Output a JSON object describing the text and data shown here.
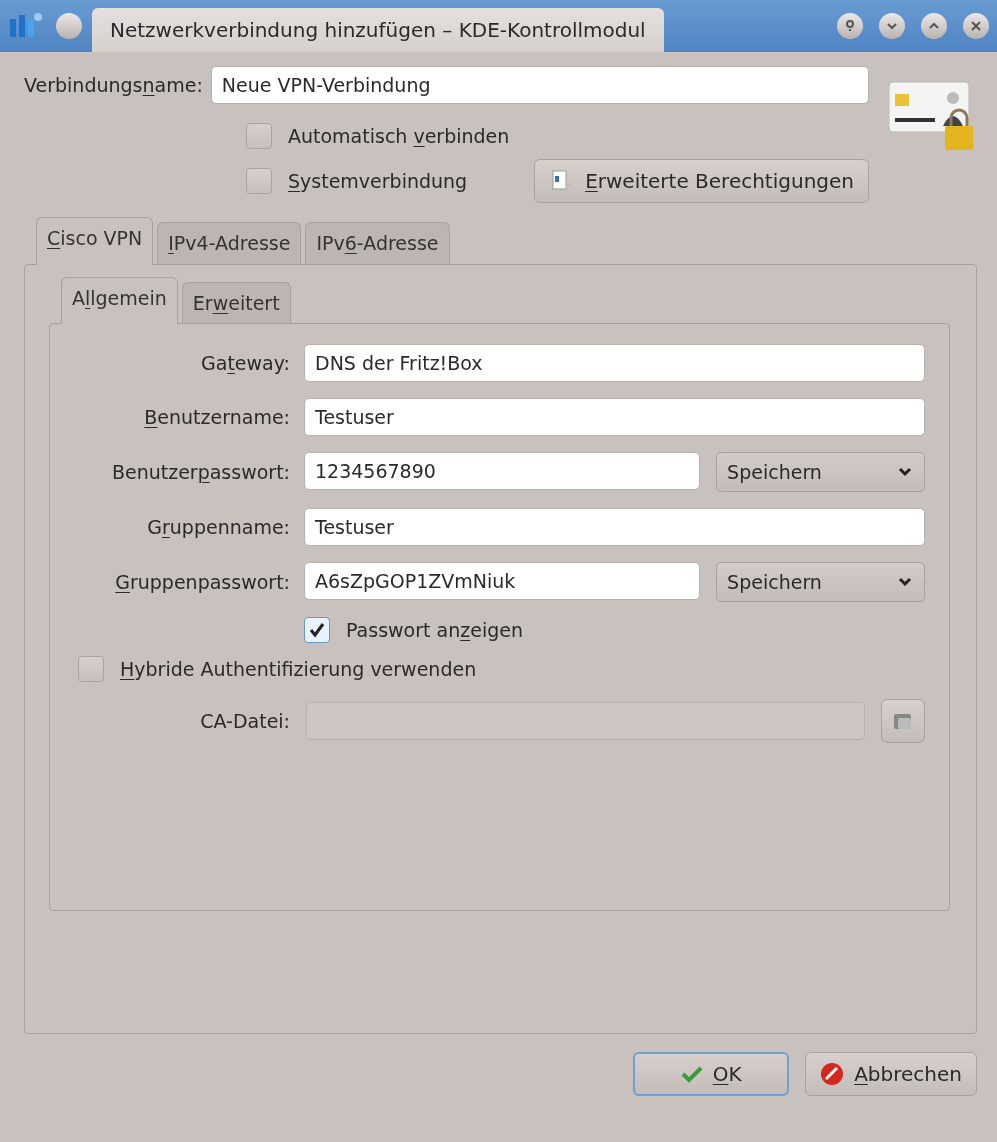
{
  "window": {
    "title": "Netzwerkverbindung hinzufügen – KDE-Kontrollmodul"
  },
  "connection_name": {
    "label": {
      "pre": "Verbindungs",
      "key": "n",
      "post": "ame:"
    },
    "value": "Neue VPN-Verbindung"
  },
  "options": [
    {
      "label": {
        "pre": "Automatisch ",
        "key": "v",
        "post": "erbinden"
      },
      "checked": false
    },
    {
      "label": {
        "key": "S",
        "post": "ystemverbindung"
      },
      "checked": false
    }
  ],
  "permissions_button": {
    "label": {
      "key": "E",
      "post": "rweiterte Berechtigungen"
    }
  },
  "tabs": [
    {
      "label": {
        "key": "C",
        "post": "isco VPN"
      },
      "selected": true
    },
    {
      "label": {
        "key": "I",
        "post": "Pv4-Adresse"
      },
      "selected": false
    },
    {
      "label": {
        "pre": "IPv",
        "key": "6",
        "post": "-Adresse"
      },
      "selected": false
    }
  ],
  "subtabs": [
    {
      "label": {
        "pre": "A",
        "key": "l",
        "post": "lgemein"
      },
      "selected": true
    },
    {
      "label": {
        "pre": "Er",
        "key": "w",
        "post": "eitert"
      },
      "selected": false
    }
  ],
  "fields": [
    {
      "kind": "text",
      "label": {
        "pre": "Ga",
        "key": "t",
        "post": "eway:"
      },
      "value": "DNS der Fritz!Box"
    },
    {
      "kind": "text",
      "label": {
        "key": "B",
        "post": "enutzername:"
      },
      "value": "Testuser"
    },
    {
      "kind": "secret",
      "label": {
        "pre": "Benutzer",
        "key": "p",
        "post": "asswort:"
      },
      "value": "1234567890",
      "store": "Speichern"
    },
    {
      "kind": "text",
      "label": {
        "pre": "G",
        "key": "r",
        "post": "uppenname:"
      },
      "value": "Testuser"
    },
    {
      "kind": "secret",
      "label": {
        "key": "G",
        "post": "ruppenpasswort:"
      },
      "value": "A6sZpGOP1ZVmNiuk",
      "store": "Speichern"
    }
  ],
  "show_password": {
    "label": {
      "pre": "Passwort an",
      "key": "z",
      "post": "eigen"
    },
    "checked": true
  },
  "hybrid_auth": {
    "label": {
      "key": "H",
      "post": "ybride Authentifizierung verwenden"
    },
    "checked": false
  },
  "ca_file": {
    "label": "CA-Datei:",
    "disabled": true
  },
  "buttons": [
    {
      "kind": "ok",
      "label": {
        "key": "O",
        "post": "K"
      },
      "focused": true
    },
    {
      "kind": "cancel",
      "label": {
        "key": "A",
        "post": "bbrechen"
      },
      "focused": false
    }
  ]
}
